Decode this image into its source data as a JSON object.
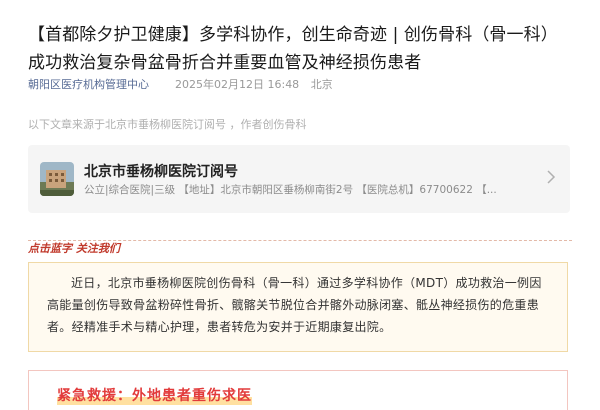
{
  "article": {
    "title": "【首都除夕护卫健康】多学科协作，创生命奇迹 | 创伤骨科（骨一科）成功救治复杂骨盆骨折合并重要血管及神经损伤患者",
    "source": "朝阳区医疗机构管理中心",
    "time": "2025年02月12日 16:48",
    "location": "北京",
    "note": "以下文章来源于北京市垂杨柳医院订阅号 ，作者创伤骨科"
  },
  "account_card": {
    "name": "北京市垂杨柳医院订阅号",
    "description": "公立|综合医院|三级 【地址】北京市朝阳区垂杨柳南街2号 【医院总机】67700622 【...",
    "avatar_icon": "hospital-building-photo",
    "chevron_icon": "chevron-right-icon"
  },
  "follow_prompt": "点击蓝字 关注我们",
  "intro_paragraph": "近日，北京市垂杨柳医院创伤骨科（骨一科）通过多学科协作（MDT）成功救治一例因高能量创伤导致骨盆粉碎性骨折、髋髂关节脱位合并髂外动脉闭塞、骶丛神经损伤的危重患者。经精准手术与精心护理，患者转危为安并于近期康复出院。",
  "section_heading": "紧急救援：外地患者重伤求医",
  "colors": {
    "link_blue": "#576b95",
    "accent_red": "#e23b3b",
    "box_border": "#f0d9a6",
    "box_bg": "#fffaf0"
  }
}
